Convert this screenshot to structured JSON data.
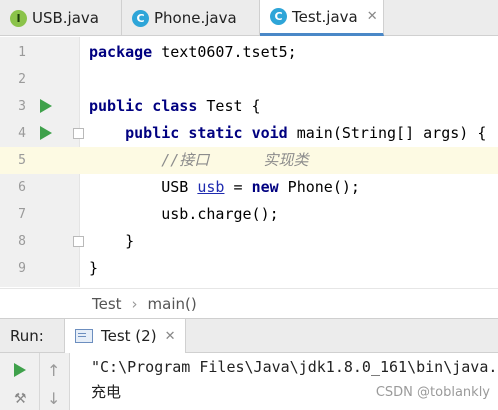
{
  "tabs": [
    {
      "label": "USB.java",
      "badge": "I",
      "active": false
    },
    {
      "label": "Phone.java",
      "badge": "C",
      "active": false
    },
    {
      "label": "Test.java",
      "badge": "C",
      "active": true
    }
  ],
  "editor": {
    "lines": [
      {
        "num": "1",
        "text": "package text0607.tset5;"
      },
      {
        "num": "2",
        "text": ""
      },
      {
        "num": "3",
        "text": "public class Test {"
      },
      {
        "num": "4",
        "text": "    public static void main(String[] args) {"
      },
      {
        "num": "5",
        "text": "        //接口      实现类"
      },
      {
        "num": "6",
        "text": "        USB usb = new Phone();"
      },
      {
        "num": "7",
        "text": "        usb.charge();"
      },
      {
        "num": "8",
        "text": "    }"
      },
      {
        "num": "9",
        "text": "}"
      }
    ],
    "tokens": {
      "package_kw": "package",
      "package_name": " text0607.tset5;",
      "public_kw": "public",
      "class_kw": "class",
      "class_name": " Test {",
      "static_kw": "static",
      "void_kw": "void",
      "main_sig": " main(String[] args) {",
      "comment": "//接口      实现类",
      "usb_type": "USB ",
      "usb_var": "usb",
      "assign": " = ",
      "new_kw": "new",
      "phone_ctor": " Phone();",
      "charge_call": "usb.charge();",
      "close_method": "}",
      "close_class": "}"
    }
  },
  "breadcrumb": {
    "class": "Test",
    "method": "main()"
  },
  "run_panel": {
    "title": "Run:",
    "tab_label": "Test (2)",
    "console": [
      "\"C:\\Program Files\\Java\\jdk1.8.0_161\\bin\\java.",
      "充电"
    ],
    "watermark": "CSDN @toblankly"
  },
  "colors": {
    "keyword": "#000080",
    "comment": "#8c8c8c",
    "run_green": "#3fa14b",
    "highlight_line": "#fdfae3",
    "active_tab_underline": "#4a88c7"
  }
}
